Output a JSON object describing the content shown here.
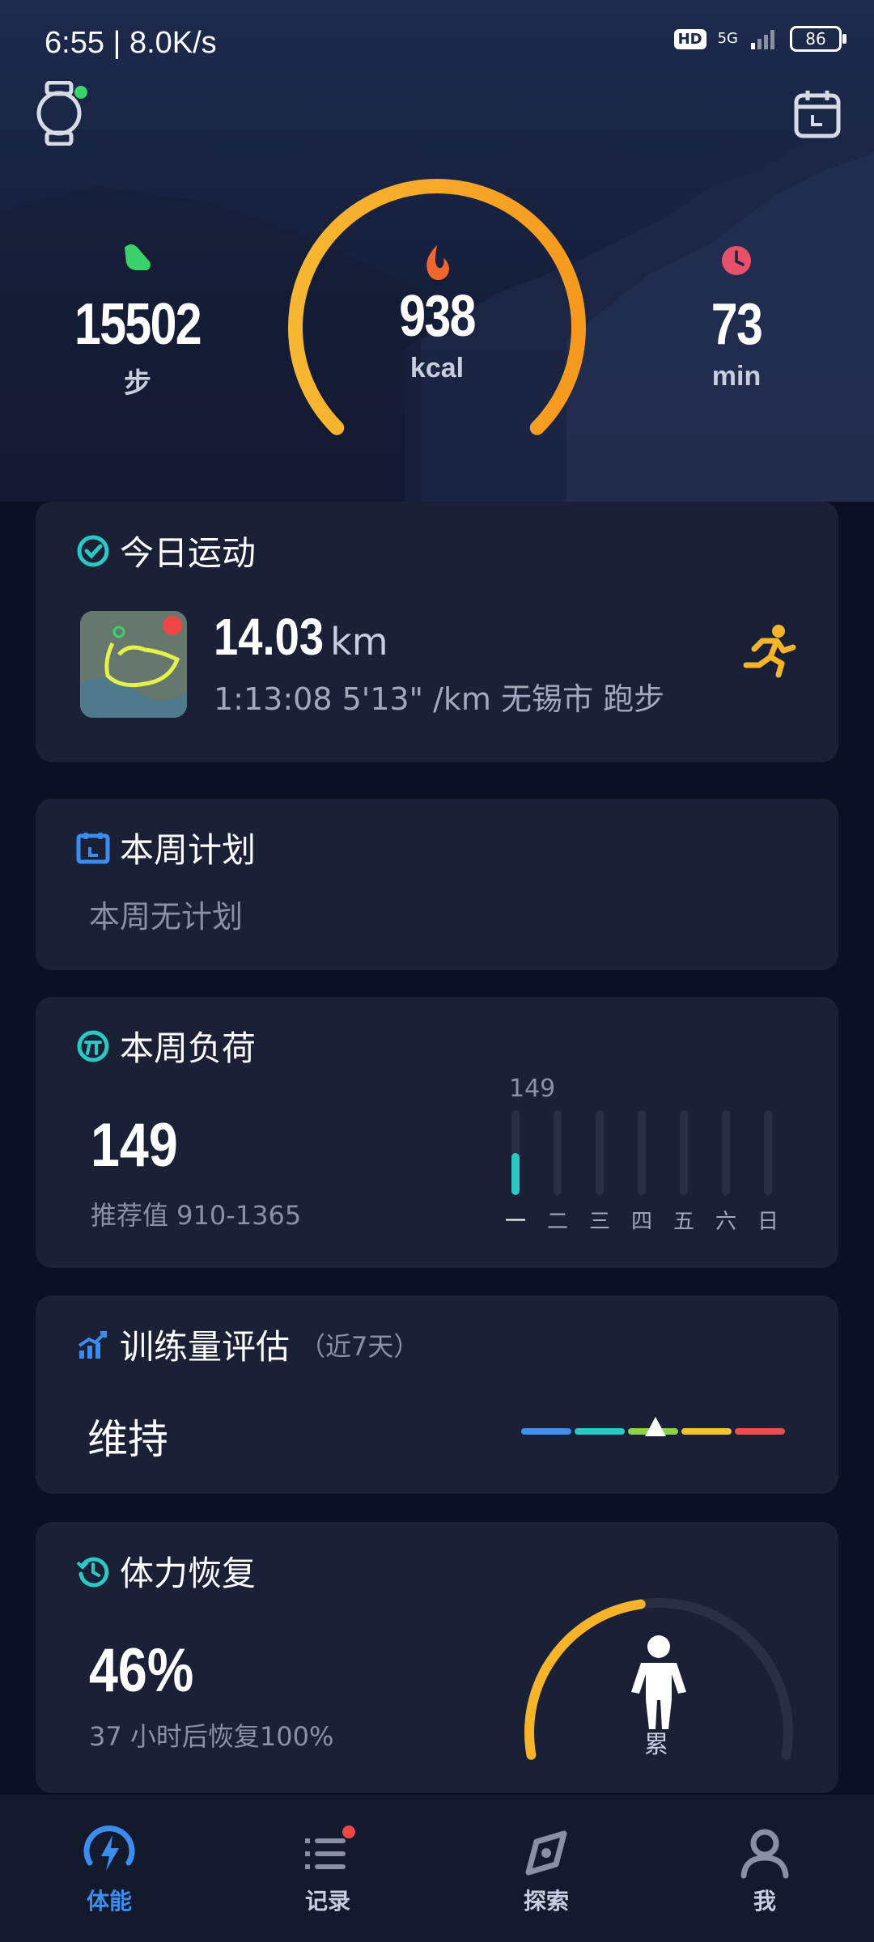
{
  "status_bar": {
    "time": "6:55 | 8.0K/s",
    "hd": "HD",
    "network": "5G",
    "battery": "86"
  },
  "summary": {
    "steps": {
      "value": "15502",
      "unit": "步"
    },
    "calories": {
      "value": "938",
      "unit": "kcal"
    },
    "minutes": {
      "value": "73",
      "unit": "min"
    },
    "ring_progress": 1.0
  },
  "today": {
    "title": "今日运动",
    "distance": "14.03",
    "distance_unit": "km",
    "details": "1:13:08  5'13\" /km  无锡市 跑步"
  },
  "week_plan": {
    "title": "本周计划",
    "text": "本周无计划"
  },
  "week_load": {
    "title": "本周负荷",
    "value": "149",
    "recommend": "推荐值 910-1365",
    "bar_top_label": "149",
    "days": [
      "一",
      "二",
      "三",
      "四",
      "五",
      "六",
      "日"
    ],
    "values": [
      149,
      0,
      0,
      0,
      0,
      0,
      0
    ],
    "max": 1365
  },
  "training": {
    "title": "训练量评估",
    "period": "（近7天）",
    "status": "维持",
    "scale_colors": [
      "#3f8ff0",
      "#2ec8c4",
      "#8bd14a",
      "#f5c231",
      "#e8504b"
    ],
    "marker_index": 2.5
  },
  "recovery": {
    "title": "体力恢复",
    "value": "46%",
    "subtitle": "37 小时后恢复100%",
    "state": "累",
    "progress": 0.46
  },
  "tabs": [
    {
      "label": "体能",
      "active": true,
      "color": "#3d8df0"
    },
    {
      "label": "记录",
      "active": false
    },
    {
      "label": "探索",
      "active": false
    },
    {
      "label": "我",
      "active": false
    }
  ]
}
